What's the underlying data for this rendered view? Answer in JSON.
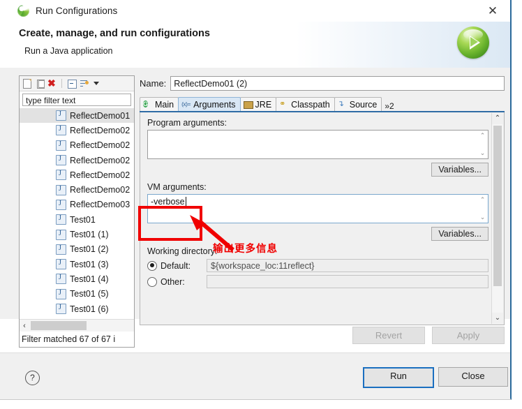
{
  "window": {
    "title": "Run Configurations",
    "title_icon": "eclipse-swirl-icon",
    "close_label": "✕"
  },
  "header": {
    "title": "Create, manage, and run configurations",
    "subtitle": "Run a Java application",
    "badge_icon": "green-run-play-icon"
  },
  "tree_panel": {
    "toolbar": [
      {
        "name": "new-configuration-icon",
        "label": ""
      },
      {
        "name": "duplicate-configuration-icon",
        "label": ""
      },
      {
        "name": "delete-configuration-icon",
        "label": ""
      },
      {
        "name": "collapse-all-icon",
        "label": ""
      },
      {
        "name": "filter-icon",
        "label": ""
      },
      {
        "name": "view-menu-chevron-icon",
        "label": ""
      }
    ],
    "filter_placeholder": "type filter text",
    "filter_value": "",
    "items": [
      {
        "label": "ReflectDemo01",
        "selected": true
      },
      {
        "label": "ReflectDemo02",
        "selected": false
      },
      {
        "label": "ReflectDemo02",
        "selected": false
      },
      {
        "label": "ReflectDemo02",
        "selected": false
      },
      {
        "label": "ReflectDemo02",
        "selected": false
      },
      {
        "label": "ReflectDemo02",
        "selected": false
      },
      {
        "label": "ReflectDemo03",
        "selected": false
      },
      {
        "label": "Test01",
        "selected": false
      },
      {
        "label": "Test01 (1)",
        "selected": false
      },
      {
        "label": "Test01 (2)",
        "selected": false
      },
      {
        "label": "Test01 (3)",
        "selected": false
      },
      {
        "label": "Test01 (4)",
        "selected": false
      },
      {
        "label": "Test01 (5)",
        "selected": false
      },
      {
        "label": "Test01 (6)",
        "selected": false
      }
    ],
    "status": "Filter matched 67 of 67 i",
    "hscroll_left_arrow": "‹"
  },
  "config": {
    "name_label": "Name:",
    "name_value": "ReflectDemo01 (2)",
    "tabs": [
      {
        "label": "Main",
        "icon": "main-tab-icon",
        "active": false
      },
      {
        "label": "Arguments",
        "icon": "arguments-tab-icon",
        "active": true
      },
      {
        "label": "JRE",
        "icon": "jre-tab-icon",
        "active": false
      },
      {
        "label": "Classpath",
        "icon": "classpath-tab-icon",
        "active": false
      },
      {
        "label": "Source",
        "icon": "source-tab-icon",
        "active": false
      }
    ],
    "tab_overflow_label": "»2",
    "program_arguments": {
      "label": "Program arguments:",
      "value": "",
      "variables_button": "Variables..."
    },
    "vm_arguments": {
      "label": "VM arguments:",
      "value": "-verbose",
      "variables_button": "Variables..."
    },
    "working_directory": {
      "label": "Working directory:",
      "default_label": "Default:",
      "default_value": "${workspace_loc:11reflect}",
      "default_selected": true,
      "other_label": "Other:",
      "other_value": "",
      "other_selected": false
    },
    "scroll_up_arrow": "⌃",
    "scroll_down_arrow": "⌄"
  },
  "actions": {
    "revert_label": "Revert",
    "apply_label": "Apply",
    "help_label": "?",
    "run_label": "Run",
    "close_label": "Close"
  },
  "annotation": {
    "text": "输出更多信息",
    "color": "#f00000",
    "shape": "rectangle-with-arrow"
  }
}
